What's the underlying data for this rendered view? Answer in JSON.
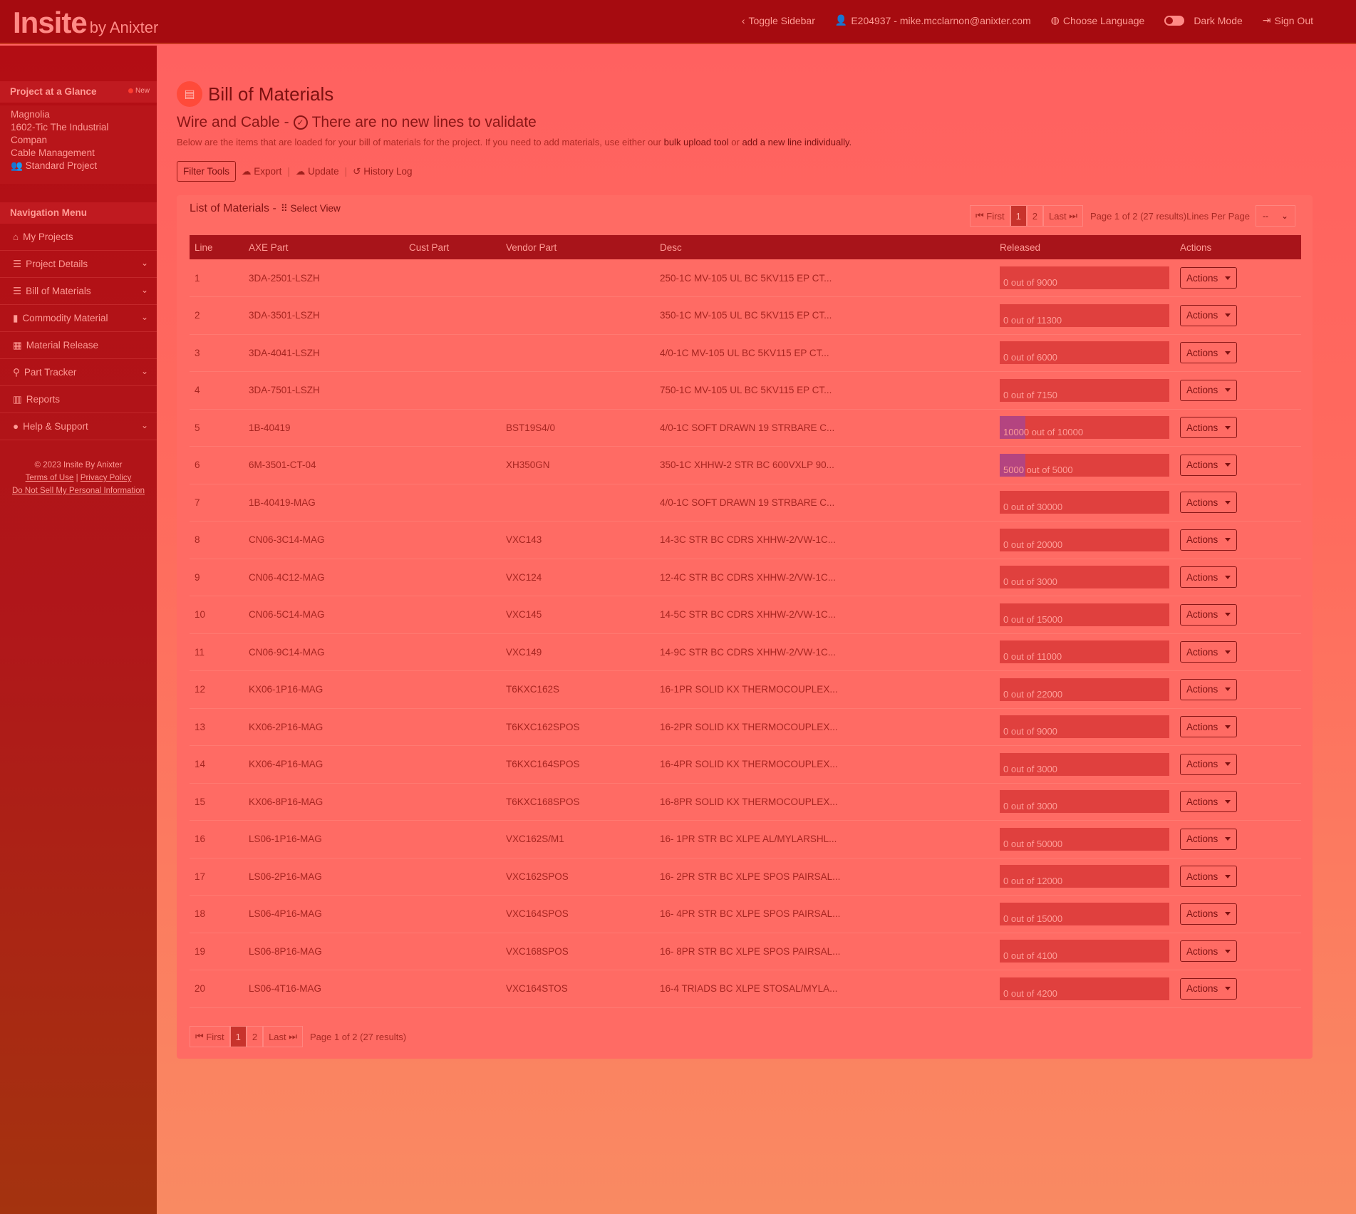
{
  "header": {
    "brand": "Insite",
    "brand_suffix": "by Anixter",
    "toggle_sidebar": "Toggle Sidebar",
    "user": "E204937 - mike.mcclarnon@anixter.com",
    "choose_language": "Choose Language",
    "dark_mode": "Dark Mode",
    "sign_out": "Sign Out"
  },
  "sidebar": {
    "project_heading": "Project at a Glance",
    "new_badge": "New",
    "project": {
      "line1": "Magnolia",
      "line2": "1602-Tic The Industrial",
      "line3": "Compan",
      "line4": "Cable Management",
      "line5": "Standard Project"
    },
    "nav_heading": "Navigation Menu",
    "items": [
      {
        "label": "My Projects",
        "icon": "⌂",
        "chevron": false
      },
      {
        "label": "Project Details",
        "icon": "☰",
        "chevron": true
      },
      {
        "label": "Bill of Materials",
        "icon": "☰",
        "chevron": true
      },
      {
        "label": "Commodity Material",
        "icon": "▮",
        "chevron": true
      },
      {
        "label": "Material Release",
        "icon": "▦",
        "chevron": false
      },
      {
        "label": "Part Tracker",
        "icon": "⚲",
        "chevron": true
      },
      {
        "label": "Reports",
        "icon": "▥",
        "chevron": false
      },
      {
        "label": "Help & Support",
        "icon": "●",
        "chevron": true
      }
    ],
    "footer": {
      "copyright": "© 2023 Insite By Anixter",
      "terms": "Terms of Use",
      "divider": "|",
      "privacy": "Privacy Policy",
      "do_not_sell": "Do Not Sell My Personal Information"
    }
  },
  "main": {
    "title": "Bill of Materials",
    "subtitle_prefix": "Wire and Cable -",
    "subtitle_status": "There are no new lines to validate",
    "intro_text": "Below are the items that are loaded for your bill of materials for the project. If you need to add materials, use either our",
    "intro_link1": "bulk upload tool",
    "intro_or": "or",
    "intro_link2": "add a new line individually.",
    "toolbar": {
      "filter": "Filter Tools",
      "export": "Export",
      "update": "Update",
      "history": "History Log",
      "sep": "|"
    },
    "list_title": "List of Materials -",
    "select_view": "Select View",
    "pager": {
      "first": "First",
      "pages": [
        "1",
        "2"
      ],
      "last": "Last",
      "page_info": "Page 1 of 2",
      "results": "(27 results)",
      "lines_per_page": "Lines Per Page",
      "lpp_value": "--"
    },
    "columns": [
      "Line",
      "AXE Part",
      "Cust Part",
      "Vendor Part",
      "Desc",
      "Released",
      "Actions"
    ],
    "action_label": "Actions",
    "rows": [
      {
        "line": "1",
        "axe": "3DA-2501-LSZH",
        "cust": "",
        "vendor": "",
        "desc": "250-1C MV-105 UL BC 5KV115 EP CT...",
        "released": "0 out of 9000",
        "progress": 0
      },
      {
        "line": "2",
        "axe": "3DA-3501-LSZH",
        "cust": "",
        "vendor": "",
        "desc": "350-1C MV-105 UL BC 5KV115 EP CT...",
        "released": "0 out of 11300",
        "progress": 0
      },
      {
        "line": "3",
        "axe": "3DA-4041-LSZH",
        "cust": "",
        "vendor": "",
        "desc": "4/0-1C MV-105 UL BC 5KV115 EP CT...",
        "released": "0 out of 6000",
        "progress": 0
      },
      {
        "line": "4",
        "axe": "3DA-7501-LSZH",
        "cust": "",
        "vendor": "",
        "desc": "750-1C MV-105 UL BC 5KV115 EP CT...",
        "released": "0 out of 7150",
        "progress": 0
      },
      {
        "line": "5",
        "axe": "1B-40419",
        "cust": "",
        "vendor": "BST19S4/0",
        "desc": "4/0-1C SOFT DRAWN 19 STRBARE C...",
        "released": "10000 out of 10000",
        "progress": 1
      },
      {
        "line": "6",
        "axe": "6M-3501-CT-04",
        "cust": "",
        "vendor": "XH350GN",
        "desc": "350-1C XHHW-2 STR BC 600VXLP 90...",
        "released": "5000 out of 5000",
        "progress": 1
      },
      {
        "line": "7",
        "axe": "1B-40419-MAG",
        "cust": "",
        "vendor": "",
        "desc": "4/0-1C SOFT DRAWN 19 STRBARE C...",
        "released": "0 out of 30000",
        "progress": 0
      },
      {
        "line": "8",
        "axe": "CN06-3C14-MAG",
        "cust": "",
        "vendor": "VXC143",
        "desc": "14-3C STR BC CDRS XHHW-2/VW-1C...",
        "released": "0 out of 20000",
        "progress": 0
      },
      {
        "line": "9",
        "axe": "CN06-4C12-MAG",
        "cust": "",
        "vendor": "VXC124",
        "desc": "12-4C STR BC CDRS XHHW-2/VW-1C...",
        "released": "0 out of 3000",
        "progress": 0
      },
      {
        "line": "10",
        "axe": "CN06-5C14-MAG",
        "cust": "",
        "vendor": "VXC145",
        "desc": "14-5C STR BC CDRS XHHW-2/VW-1C...",
        "released": "0 out of 15000",
        "progress": 0
      },
      {
        "line": "11",
        "axe": "CN06-9C14-MAG",
        "cust": "",
        "vendor": "VXC149",
        "desc": "14-9C STR BC CDRS XHHW-2/VW-1C...",
        "released": "0 out of 11000",
        "progress": 0
      },
      {
        "line": "12",
        "axe": "KX06-1P16-MAG",
        "cust": "",
        "vendor": "T6KXC162S",
        "desc": "16-1PR SOLID KX THERMOCOUPLEX...",
        "released": "0 out of 22000",
        "progress": 0
      },
      {
        "line": "13",
        "axe": "KX06-2P16-MAG",
        "cust": "",
        "vendor": "T6KXC162SPOS",
        "desc": "16-2PR SOLID KX THERMOCOUPLEX...",
        "released": "0 out of 9000",
        "progress": 0
      },
      {
        "line": "14",
        "axe": "KX06-4P16-MAG",
        "cust": "",
        "vendor": "T6KXC164SPOS",
        "desc": "16-4PR SOLID KX THERMOCOUPLEX...",
        "released": "0 out of 3000",
        "progress": 0
      },
      {
        "line": "15",
        "axe": "KX06-8P16-MAG",
        "cust": "",
        "vendor": "T6KXC168SPOS",
        "desc": "16-8PR SOLID KX THERMOCOUPLEX...",
        "released": "0 out of 3000",
        "progress": 0
      },
      {
        "line": "16",
        "axe": "LS06-1P16-MAG",
        "cust": "",
        "vendor": "VXC162S/M1",
        "desc": "16- 1PR STR BC XLPE AL/MYLARSHL...",
        "released": "0 out of 50000",
        "progress": 0
      },
      {
        "line": "17",
        "axe": "LS06-2P16-MAG",
        "cust": "",
        "vendor": "VXC162SPOS",
        "desc": "16- 2PR STR BC XLPE SPOS PAIRSAL...",
        "released": "0 out of 12000",
        "progress": 0
      },
      {
        "line": "18",
        "axe": "LS06-4P16-MAG",
        "cust": "",
        "vendor": "VXC164SPOS",
        "desc": "16- 4PR STR BC XLPE SPOS PAIRSAL...",
        "released": "0 out of 15000",
        "progress": 0
      },
      {
        "line": "19",
        "axe": "LS06-8P16-MAG",
        "cust": "",
        "vendor": "VXC168SPOS",
        "desc": "16- 8PR STR BC XLPE SPOS PAIRSAL...",
        "released": "0 out of 4100",
        "progress": 0
      },
      {
        "line": "20",
        "axe": "LS06-4T16-MAG",
        "cust": "",
        "vendor": "VXC164STOS",
        "desc": "16-4 TRIADS BC XLPE STOSAL/MYLA...",
        "released": "0 out of 4200",
        "progress": 0
      }
    ]
  }
}
